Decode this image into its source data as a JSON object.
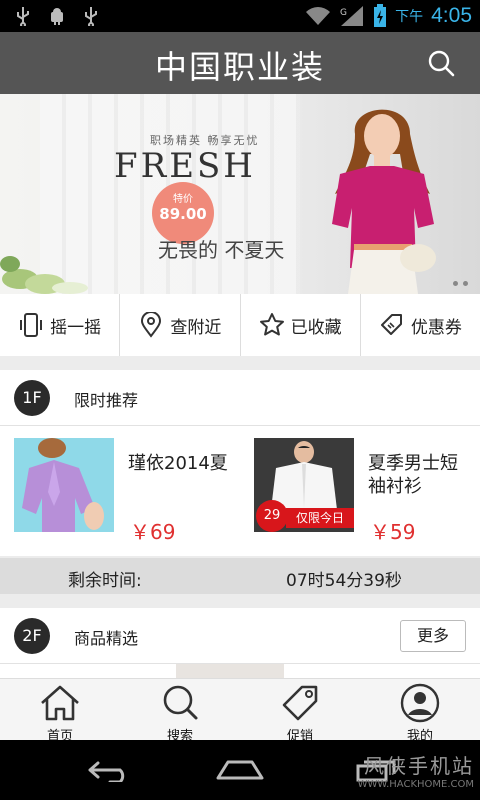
{
  "status_bar": {
    "ampm": "下午",
    "time": "4:05",
    "icons": [
      "usb-icon",
      "android-debug-icon",
      "usb-icon",
      "wifi-icon",
      "signal-icon",
      "battery-charging-icon"
    ]
  },
  "header": {
    "title": "中国职业装",
    "search_icon": "search-icon"
  },
  "banner": {
    "tagline": "职场精英 畅享无忧",
    "headline": "FRESH",
    "price_prefix": "特价",
    "price": "89.00",
    "slogan": "无畏的 不夏天",
    "page_count": 2
  },
  "actions": [
    {
      "label": "摇一摇",
      "icon": "shake-phone-icon"
    },
    {
      "label": "查附近",
      "icon": "location-pin-icon"
    },
    {
      "label": "已收藏",
      "icon": "star-icon"
    },
    {
      "label": "优惠券",
      "icon": "coupon-tag-icon"
    }
  ],
  "floor1": {
    "badge": "1F",
    "title": "限时推荐",
    "products": [
      {
        "name": "瑾依2014夏",
        "price": "￥69"
      },
      {
        "name": "夏季男士短袖衬衫",
        "price": "￥59",
        "ribbon": "仅限今日",
        "ribbon_price": "29"
      }
    ]
  },
  "timer": {
    "label": "剩余时间:",
    "value": "07时54分39秒"
  },
  "floor2": {
    "badge": "2F",
    "title": "商品精选",
    "more": "更多"
  },
  "bottom_nav": [
    {
      "label": "首页",
      "icon": "home-icon"
    },
    {
      "label": "搜索",
      "icon": "search-icon"
    },
    {
      "label": "促销",
      "icon": "tag-icon"
    },
    {
      "label": "我的",
      "icon": "user-icon"
    }
  ],
  "watermark": {
    "line1": "风侠手机站",
    "line2": "WWW.HACKHOME.COM"
  },
  "colors": {
    "titlebar": "#555555",
    "price": "#e03030",
    "status_time": "#3ab4e8"
  }
}
